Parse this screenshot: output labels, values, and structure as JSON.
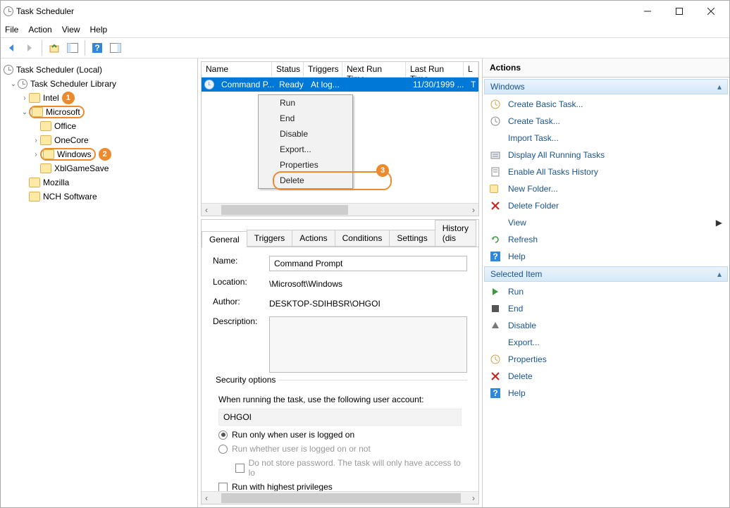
{
  "window": {
    "title": "Task Scheduler"
  },
  "menu": {
    "file": "File",
    "action": "Action",
    "view": "View",
    "help": "Help"
  },
  "tree": {
    "root": "Task Scheduler (Local)",
    "library": "Task Scheduler Library",
    "intel": "Intel",
    "microsoft": "Microsoft",
    "office": "Office",
    "onecore": "OneCore",
    "windows": "Windows",
    "xblgamesave": "XblGameSave",
    "mozilla": "Mozilla",
    "nch": "NCH Software"
  },
  "badges": {
    "b1": "1",
    "b2": "2",
    "b3": "3"
  },
  "list": {
    "headers": {
      "name": "Name",
      "status": "Status",
      "triggers": "Triggers",
      "nextrun": "Next Run Time",
      "lastrun": "Last Run Time",
      "l": "L"
    },
    "row": {
      "name": "Command P...",
      "status": "Ready",
      "triggers": "At log...",
      "nextrun": "",
      "lastrun": "11/30/1999 ...",
      "l": "T"
    }
  },
  "contextmenu": {
    "run": "Run",
    "end": "End",
    "disable": "Disable",
    "export": "Export...",
    "properties": "Properties",
    "delete": "Delete"
  },
  "tabs": {
    "general": "General",
    "triggers": "Triggers",
    "actions": "Actions",
    "conditions": "Conditions",
    "settings": "Settings",
    "history": "History (dis"
  },
  "details": {
    "name_label": "Name:",
    "name_value": "Command Prompt",
    "location_label": "Location:",
    "location_value": "\\Microsoft\\Windows",
    "author_label": "Author:",
    "author_value": "DESKTOP-SDIHBSR\\OHGOI",
    "description_label": "Description:"
  },
  "security": {
    "legend": "Security options",
    "prompt": "When running the task, use the following user account:",
    "user": "OHGOI",
    "opt_logged_on": "Run only when user is logged on",
    "opt_not_logged": "Run whether user is logged on or not",
    "opt_no_store": "Do not store password.  The task will only have access to lo",
    "opt_highest": "Run with highest privileges"
  },
  "actions": {
    "title": "Actions",
    "section1": "Windows",
    "create_basic": "Create Basic Task...",
    "create_task": "Create Task...",
    "import": "Import Task...",
    "display_running": "Display All Running Tasks",
    "enable_history": "Enable All Tasks History",
    "new_folder": "New Folder...",
    "delete_folder": "Delete Folder",
    "view": "View",
    "refresh": "Refresh",
    "help1": "Help",
    "section2": "Selected Item",
    "run": "Run",
    "end": "End",
    "disable": "Disable",
    "export": "Export...",
    "properties": "Properties",
    "delete": "Delete",
    "help2": "Help"
  }
}
